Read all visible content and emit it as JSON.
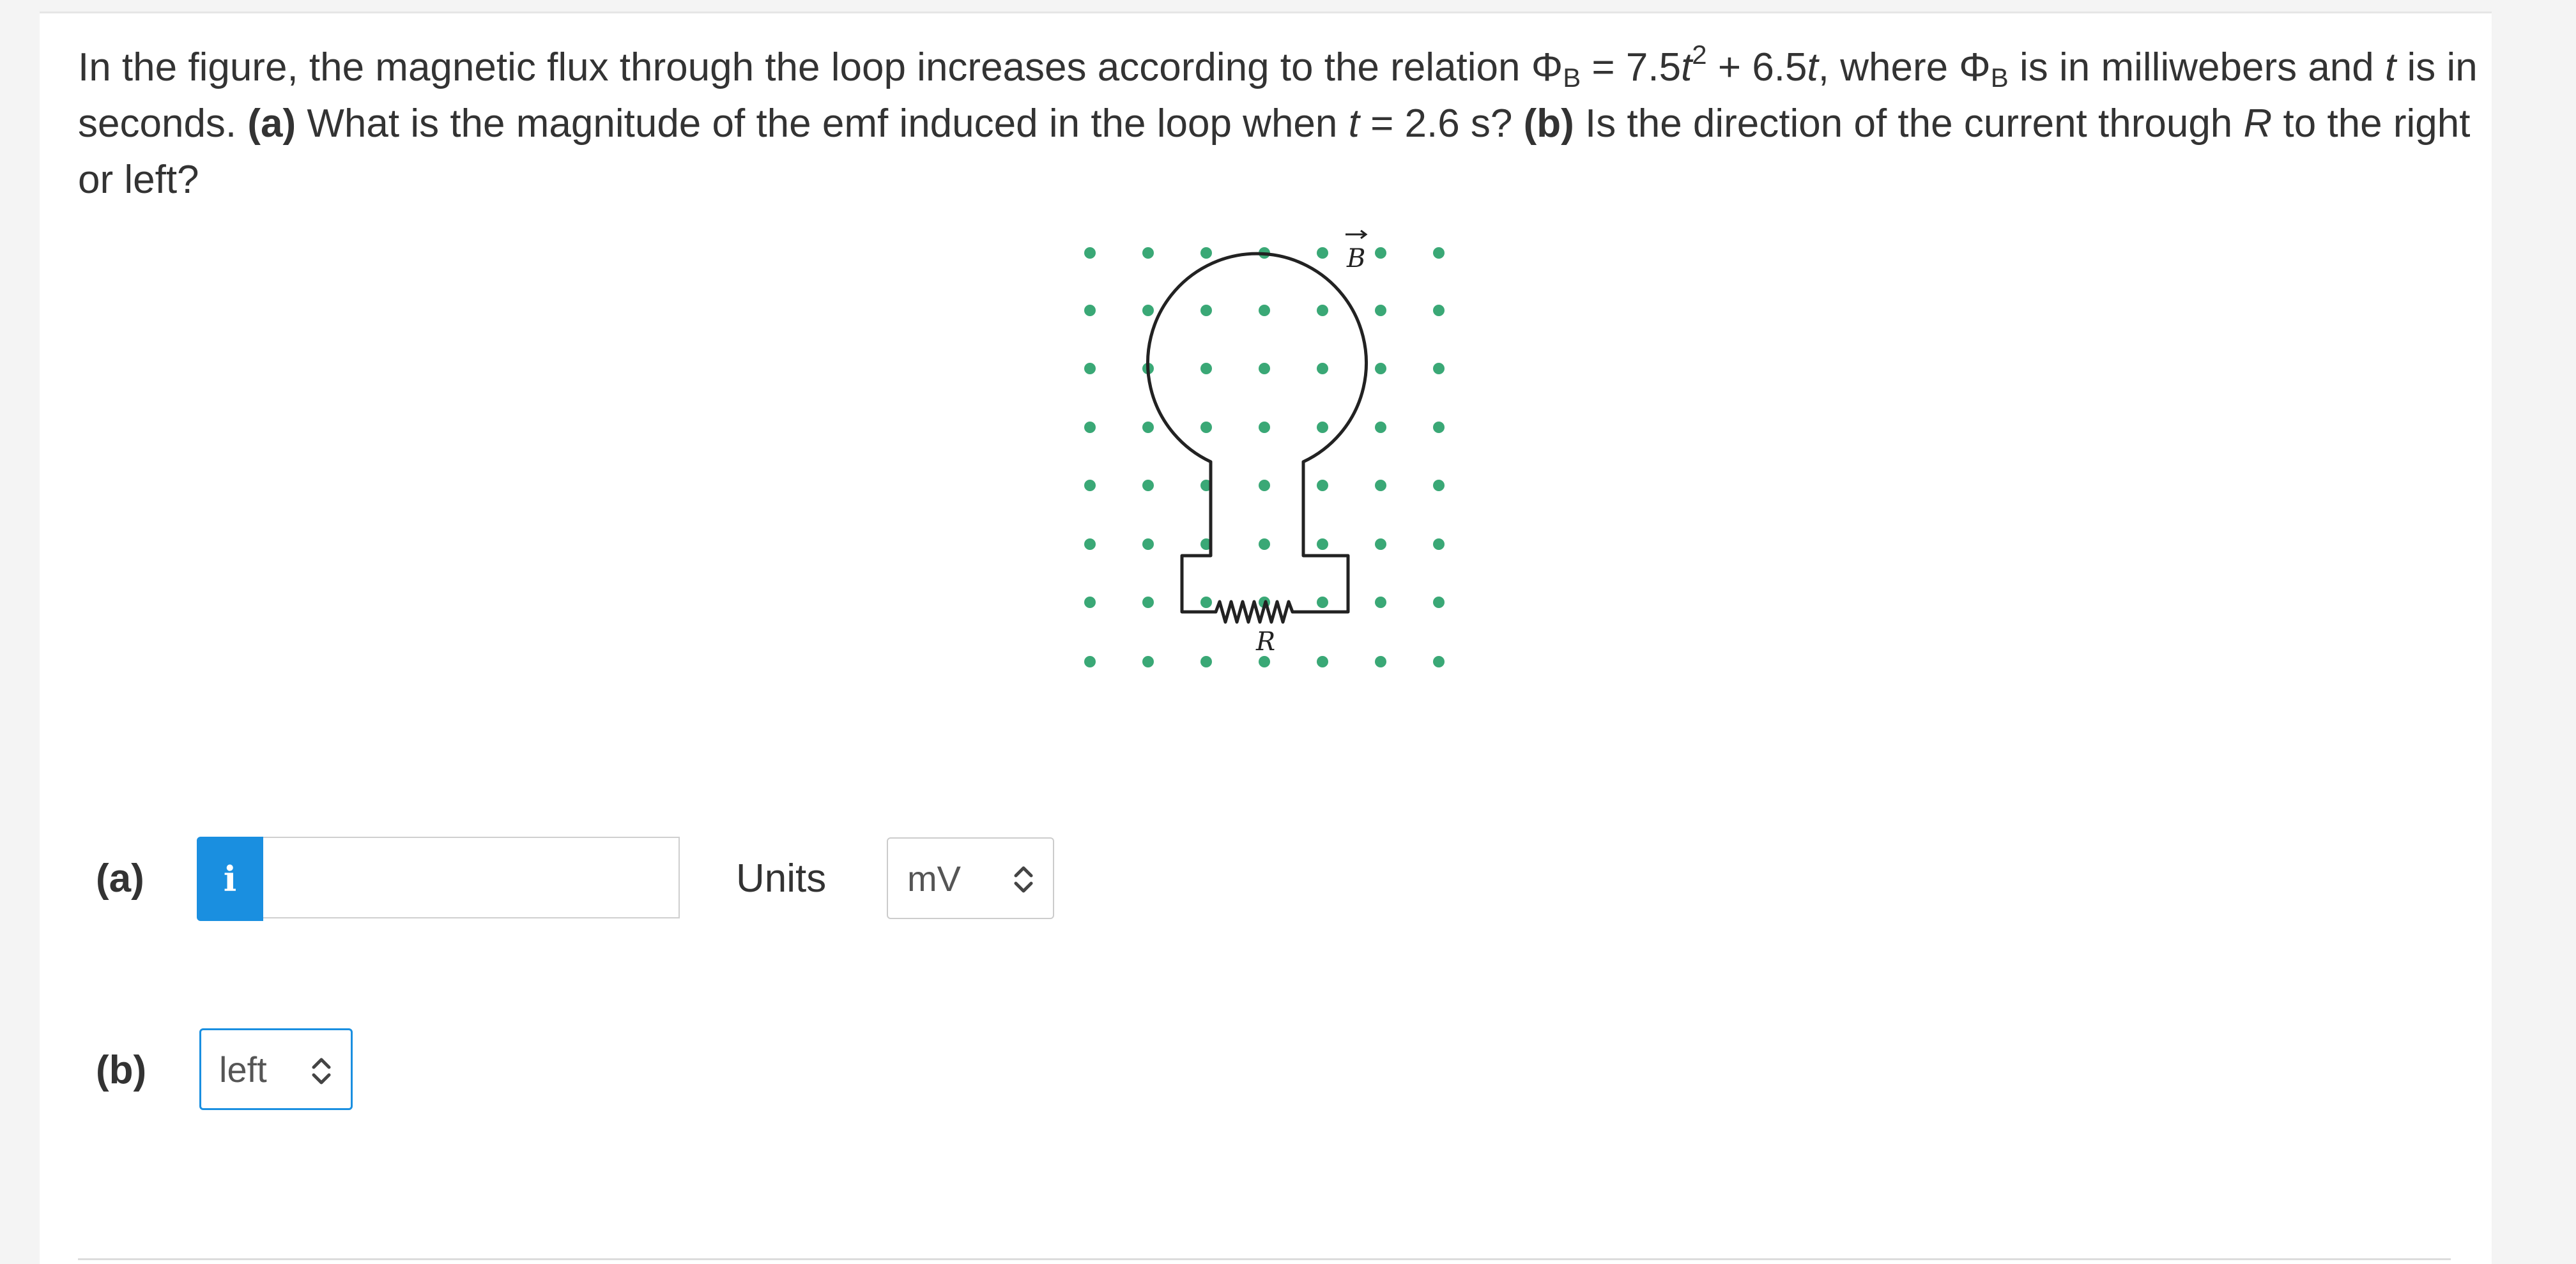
{
  "question": {
    "intro": "In the figure, the magnetic flux through the loop increases according to the relation ",
    "phi_symbol": "Φ",
    "phi_subscript": "B",
    "relation_eq": " = 7.5",
    "var_t": "t",
    "exponent": "2",
    "relation_tail": " + 6.5",
    "where_text": ", where ",
    "units_text": " is in milliwebers and ",
    "seconds_text": " is in seconds. ",
    "part_a_tag": "(a)",
    "part_a_text": " What is the magnitude of the emf induced in the loop when ",
    "time_value": " = 2.6 s? ",
    "part_b_tag": "(b)",
    "part_b_text": " Is the direction of the current through ",
    "resistor_var": "R",
    "part_b_tail": " to the right or left?"
  },
  "figure": {
    "field_label": "B",
    "resistor_label": "R",
    "dot_color": "#3aa876",
    "wire_color": "#222222"
  },
  "answer_a": {
    "label": "(a)",
    "info_icon_glyph": "i",
    "value": "",
    "units_label": "Units",
    "units_selected": "mV"
  },
  "answer_b": {
    "label": "(b)",
    "direction_selected": "left"
  },
  "colors": {
    "accent": "#1a8fe0"
  }
}
